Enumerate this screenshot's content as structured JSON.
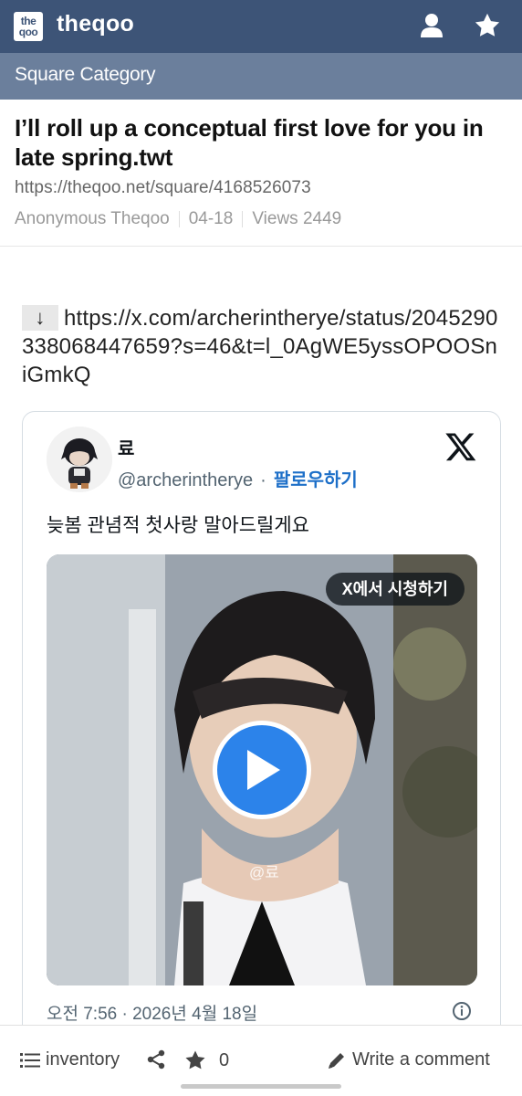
{
  "app": {
    "logo_line1": "the",
    "logo_line2": "qoo",
    "name": "theqoo",
    "icons": [
      "user-icon",
      "star-icon"
    ]
  },
  "category": "Square Category",
  "post": {
    "title": "I’ll roll up a conceptual first love for you in late spring.twt",
    "url": "https://theqoo.net/square/4168526073",
    "author": "Anonymous Theqoo",
    "date": "04-18",
    "views": "Views 2449"
  },
  "body": {
    "arrow": "↓",
    "link": "https://x.com/archerintherye/status/2045290338068447659?s=46&t=l_0AgWE5yssOPOOSniGmkQ"
  },
  "tweet": {
    "name": "료",
    "handle": "@archerintherye",
    "separator": "·",
    "follow": "팔로우하기",
    "text": "늦봄 관념적 첫사랑 말아드릴게요",
    "watch_label": "X에서 시청하기",
    "watermark": "@료",
    "date": "오전 7:56 · 2026년 4월 18일",
    "icons": [
      "x-logo-icon",
      "play-icon",
      "info-icon"
    ]
  },
  "bottombar": {
    "inventory": "inventory",
    "star_count": "0",
    "comment": "Write a comment"
  },
  "colors": {
    "header": "#3d5477",
    "category_bar": "#6b7f9c",
    "link_blue": "#1d6fc8",
    "play_blue": "#2c83ea"
  }
}
